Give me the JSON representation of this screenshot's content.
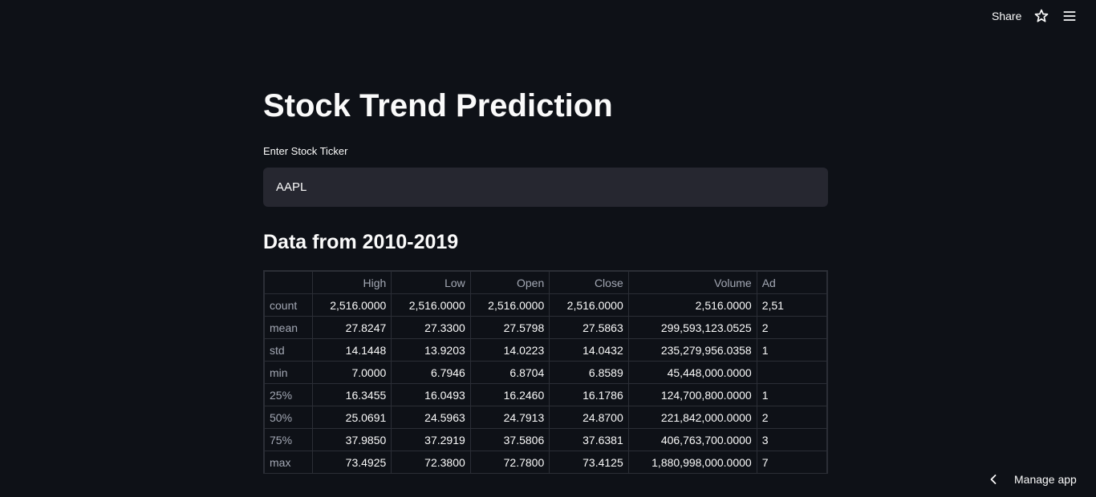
{
  "header": {
    "share_label": "Share",
    "icons": [
      "star-icon",
      "hamburger-menu-icon"
    ]
  },
  "main": {
    "title": "Stock Trend Prediction",
    "ticker_label": "Enter Stock Ticker",
    "ticker_value": "AAPL",
    "section_title": "Data from 2010-2019"
  },
  "table": {
    "columns": [
      "",
      "High",
      "Low",
      "Open",
      "Close",
      "Volume",
      "Ad"
    ],
    "rows": [
      {
        "label": "count",
        "cells": [
          "2,516.0000",
          "2,516.0000",
          "2,516.0000",
          "2,516.0000",
          "2,516.0000",
          "2,51"
        ]
      },
      {
        "label": "mean",
        "cells": [
          "27.8247",
          "27.3300",
          "27.5798",
          "27.5863",
          "299,593,123.0525",
          "2"
        ]
      },
      {
        "label": "std",
        "cells": [
          "14.1448",
          "13.9203",
          "14.0223",
          "14.0432",
          "235,279,956.0358",
          "1"
        ]
      },
      {
        "label": "min",
        "cells": [
          "7.0000",
          "6.7946",
          "6.8704",
          "6.8589",
          "45,448,000.0000",
          ""
        ]
      },
      {
        "label": "25%",
        "cells": [
          "16.3455",
          "16.0493",
          "16.2460",
          "16.1786",
          "124,700,800.0000",
          "1"
        ]
      },
      {
        "label": "50%",
        "cells": [
          "25.0691",
          "24.5963",
          "24.7913",
          "24.8700",
          "221,842,000.0000",
          "2"
        ]
      },
      {
        "label": "75%",
        "cells": [
          "37.9850",
          "37.2919",
          "37.5806",
          "37.6381",
          "406,763,700.0000",
          "3"
        ]
      },
      {
        "label": "max",
        "cells": [
          "73.4925",
          "72.3800",
          "72.7800",
          "73.4125",
          "1,880,998,000.0000",
          "7"
        ]
      }
    ]
  },
  "footer": {
    "manage_label": "Manage app",
    "icon": "chevron-left-icon"
  },
  "colors": {
    "background": "#0e1117",
    "input_bg": "#262730",
    "text": "#fafafa",
    "muted_text": "#a3a8b4",
    "border": "#2b2e36"
  }
}
